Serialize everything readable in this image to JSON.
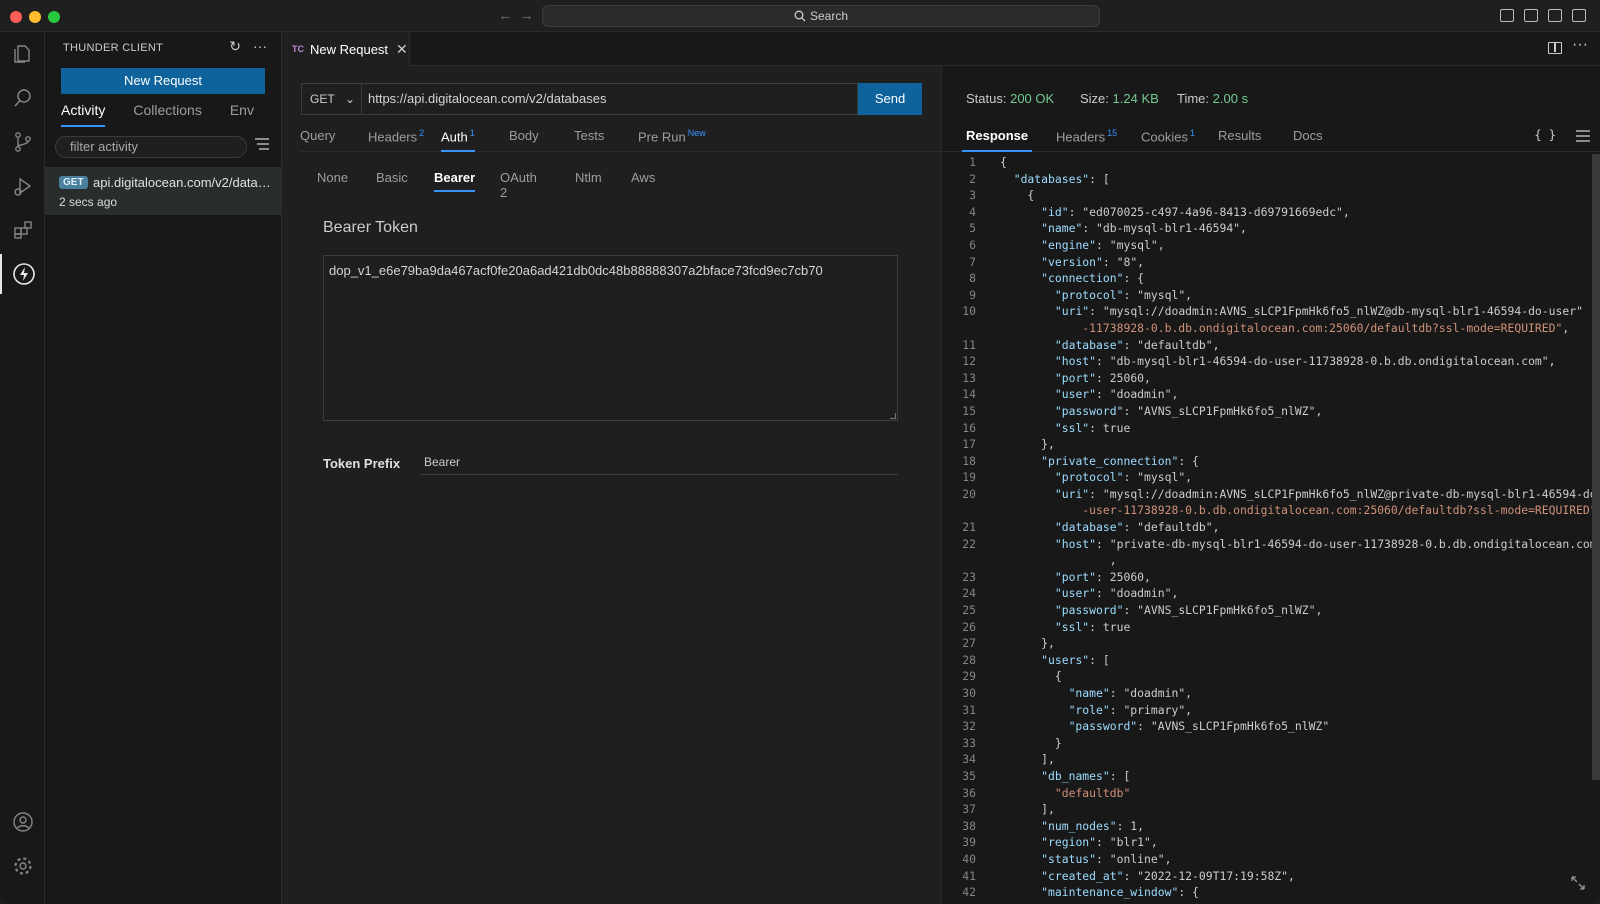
{
  "window": {
    "search_label": "Search"
  },
  "sidebar": {
    "title": "THUNDER CLIENT",
    "new_request_label": "New Request",
    "tabs": [
      "Activity",
      "Collections",
      "Env"
    ],
    "filter_placeholder": "filter activity",
    "activity": [
      {
        "method": "GET",
        "url": "api.digitalocean.com/v2/databases",
        "time": "2 secs ago"
      }
    ]
  },
  "editor": {
    "tab_badge": "TC",
    "tab_label": "New Request",
    "method": "GET",
    "url": "https://api.digitalocean.com/v2/databases",
    "send_label": "Send",
    "request_tabs": [
      {
        "label": "Query",
        "count": ""
      },
      {
        "label": "Headers",
        "count": "2"
      },
      {
        "label": "Auth",
        "count": "1"
      },
      {
        "label": "Body",
        "count": ""
      },
      {
        "label": "Tests",
        "count": ""
      },
      {
        "label": "Pre Run",
        "count": "New"
      }
    ],
    "auth_tabs": [
      "None",
      "Basic",
      "Bearer",
      "OAuth 2",
      "Ntlm",
      "Aws"
    ],
    "bearer_title": "Bearer Token",
    "token": "dop_v1_e6e79ba9da467acf0fe20a6ad421db0dc48b88888307a2bface73fcd9ec7cb70",
    "token_prefix_label": "Token Prefix",
    "token_prefix_value": "Bearer"
  },
  "response": {
    "status_label": "Status:",
    "status_value": "200 OK",
    "size_label": "Size:",
    "size_value": "1.24 KB",
    "time_label": "Time:",
    "time_value": "2.00 s",
    "tabs": [
      {
        "label": "Response",
        "count": ""
      },
      {
        "label": "Headers",
        "count": "15"
      },
      {
        "label": "Cookies",
        "count": "1"
      },
      {
        "label": "Results",
        "count": ""
      },
      {
        "label": "Docs",
        "count": ""
      }
    ],
    "format_icon": "{ }",
    "code_lines": [
      "{",
      "  \"databases\": [",
      "    {",
      "      \"id\": \"ed070025-c497-4a96-8413-d69791669edc\",",
      "      \"name\": \"db-mysql-blr1-46594\",",
      "      \"engine\": \"mysql\",",
      "      \"version\": \"8\",",
      "      \"connection\": {",
      "        \"protocol\": \"mysql\",",
      "        \"uri\": \"mysql://doadmin:AVNS_sLCP1FpmHk6fo5_nlWZ@db-mysql-blr1-46594-do-user\n            -11738928-0.b.db.ondigitalocean.com:25060/defaultdb?ssl-mode=REQUIRED\",",
      "        \"database\": \"defaultdb\",",
      "        \"host\": \"db-mysql-blr1-46594-do-user-11738928-0.b.db.ondigitalocean.com\",",
      "        \"port\": 25060,",
      "        \"user\": \"doadmin\",",
      "        \"password\": \"AVNS_sLCP1FpmHk6fo5_nlWZ\",",
      "        \"ssl\": true",
      "      },",
      "      \"private_connection\": {",
      "        \"protocol\": \"mysql\",",
      "        \"uri\": \"mysql://doadmin:AVNS_sLCP1FpmHk6fo5_nlWZ@private-db-mysql-blr1-46594-do\n            -user-11738928-0.b.db.ondigitalocean.com:25060/defaultdb?ssl-mode=REQUIRED\",",
      "        \"database\": \"defaultdb\",",
      "        \"host\": \"private-db-mysql-blr1-46594-do-user-11738928-0.b.db.ondigitalocean.com\"\n                ,",
      "        \"port\": 25060,",
      "        \"user\": \"doadmin\",",
      "        \"password\": \"AVNS_sLCP1FpmHk6fo5_nlWZ\",",
      "        \"ssl\": true",
      "      },",
      "      \"users\": [",
      "        {",
      "          \"name\": \"doadmin\",",
      "          \"role\": \"primary\",",
      "          \"password\": \"AVNS_sLCP1FpmHk6fo5_nlWZ\"",
      "        }",
      "      ],",
      "      \"db_names\": [",
      "        \"defaultdb\"",
      "      ],",
      "      \"num_nodes\": 1,",
      "      \"region\": \"blr1\",",
      "      \"status\": \"online\",",
      "      \"created_at\": \"2022-12-09T17:19:58Z\",",
      "      \"maintenance_window\": {"
    ]
  },
  "colors": {
    "accent": "#3794ff",
    "button": "#0e639c",
    "status_ok": "#73c991",
    "json_key": "#9cdcfe",
    "json_string": "#ce9178",
    "json_number": "#b5cea8",
    "json_bool": "#569cd6"
  }
}
